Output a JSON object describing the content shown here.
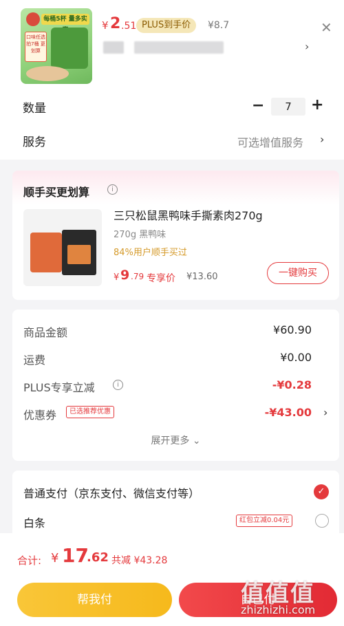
{
  "product": {
    "badge_text": "每桶5杯 量多实惠",
    "flavor_tag": "口味任选 拍7桶 更划算",
    "price_currency": "¥",
    "price_int": "2",
    "price_dec": ".51",
    "plus_tag": "PLUS到手价",
    "original_price": "¥8.7"
  },
  "quantity": {
    "label": "数量",
    "value": "7",
    "minus": "−",
    "plus": "+"
  },
  "service": {
    "label": "服务",
    "value": "可选增值服务"
  },
  "upsell": {
    "title": "顺手买更划算",
    "name": "三只松鼠黑鸭味手撕素肉270g",
    "spec": "270g 黑鸭味",
    "bought": "84%用户顺手买过",
    "price_currency": "¥",
    "price_int": "9",
    "price_dec": ".79",
    "vip_label": "专享价",
    "original_price": "¥13.60",
    "buy_button": "一键购买"
  },
  "summary": {
    "goods_label": "商品金额",
    "goods_value": "¥60.90",
    "shipping_label": "运费",
    "shipping_value": "¥0.00",
    "plus_label": "PLUS专享立减",
    "plus_value": "-¥0.28",
    "coupon_label": "优惠券",
    "coupon_tag": "已选推荐优惠",
    "coupon_value": "-¥43.00",
    "expand": "展开更多"
  },
  "payment": {
    "normal_label": "普通支付（京东支付、微信支付等）",
    "baitiao_label": "白条",
    "baitiao_promo": "红包立减0.04元"
  },
  "bottom": {
    "total_label": "合计:",
    "total_currency": "¥",
    "total_int": "17",
    "total_dec": ".62",
    "total_save": "共减 ¥43.28",
    "help_pay": "帮我付",
    "self_pay": "自己付",
    "watermark_big": "值值值",
    "watermark_small": "zhizhizhi.com"
  },
  "colors": {
    "accent_red": "#e4393c",
    "help_yellow": "#f6b91c",
    "plus_gold": "#f5e7b8"
  }
}
